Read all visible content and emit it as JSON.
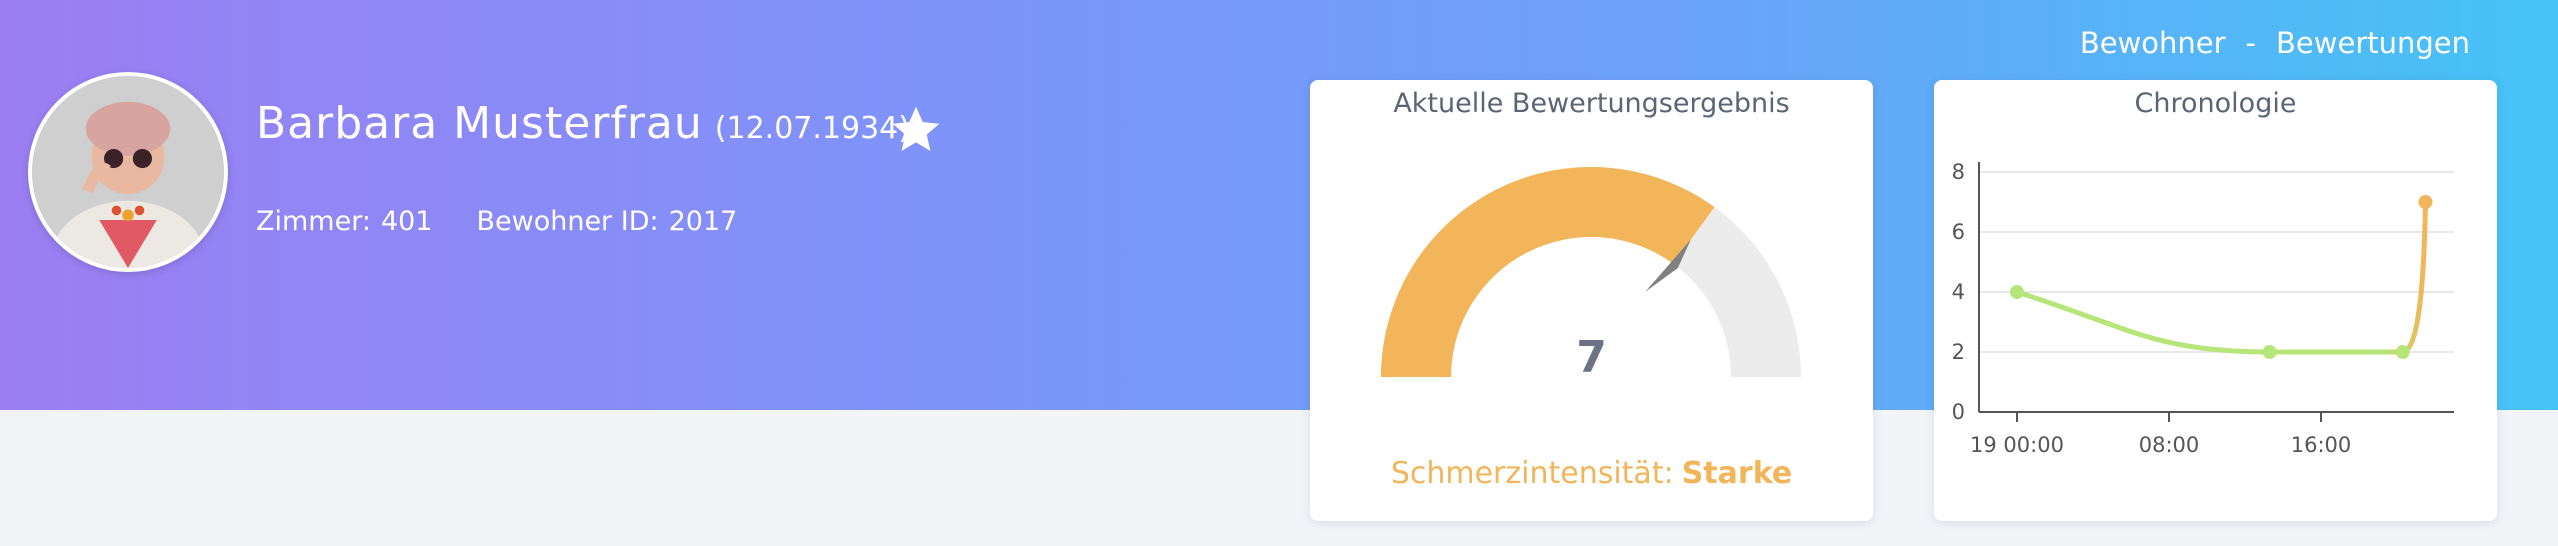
{
  "breadcrumb": {
    "item1": "Bewohner",
    "separator": "-",
    "item2": "Bewertungen"
  },
  "resident": {
    "name": "Barbara Musterfrau",
    "dob": "(12.07.1934)",
    "room_label": "Zimmer:",
    "room_value": "401",
    "id_label": "Bewohner ID:",
    "id_value": "2017",
    "favorite_icon": "star-icon"
  },
  "gauge": {
    "title": "Aktuelle Bewertungsergebnis",
    "value": "7",
    "level_value": 7,
    "level_max": 10,
    "intensity_label": "Schmerzintensität:",
    "intensity_level": "Starke",
    "fill_color": "#f2b55a",
    "track_color": "#ececec",
    "pointer_color": "#808080"
  },
  "chrono": {
    "title": "Chronologie"
  },
  "chart_data": {
    "type": "line",
    "title": "Chronologie",
    "xlabel": "",
    "ylabel": "",
    "x_tick_labels": [
      "19 00:00",
      "08:00",
      "16:00"
    ],
    "x_ticks_hours": [
      0,
      8,
      16
    ],
    "y_ticks": [
      0,
      2,
      4,
      6,
      8
    ],
    "ylim": [
      0,
      8
    ],
    "xlim_hours": [
      -2,
      23
    ],
    "grid": true,
    "series": [
      {
        "x_hours": [
          0,
          13.3,
          20.3,
          21.5
        ],
        "values": [
          4,
          2,
          2,
          7
        ],
        "colors": [
          "#b6e57a",
          "#b6e57a",
          "#b6e57a",
          "#f2b55a"
        ]
      }
    ]
  }
}
